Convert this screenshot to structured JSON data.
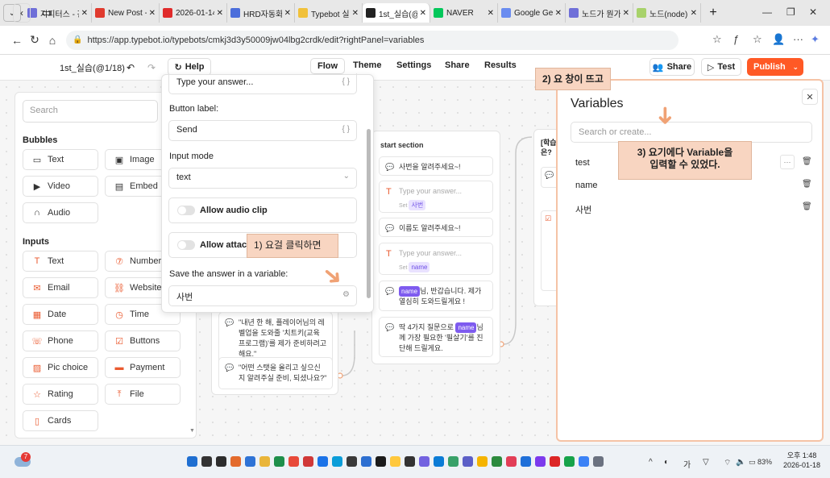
{
  "browser": {
    "tabs": [
      {
        "label": "지피터스 - 관",
        "color": "#6f6fd8",
        "active": false
      },
      {
        "label": "New Post - AI",
        "color": "#e03a2e",
        "active": false
      },
      {
        "label": "2026-01-14 |",
        "color": "#e02b2b",
        "active": false
      },
      {
        "label": "HRD자동화 1",
        "color": "#4c6edb",
        "active": false
      },
      {
        "label": "Typebot 실습",
        "color": "#f1c13a",
        "active": false
      },
      {
        "label": "1st_실습(@1/",
        "color": "#222222",
        "active": true
      },
      {
        "label": "NAVER",
        "color": "#03c75a",
        "active": false
      },
      {
        "label": "Google Gemi",
        "color": "#6a8cf0",
        "active": false
      },
      {
        "label": "노드가 뭔가요",
        "color": "#6f6fd8",
        "active": false
      },
      {
        "label": "노드(node) 의",
        "color": "#a8d26b",
        "active": false
      }
    ],
    "url": "https://app.typebot.io/typebots/cmkj3d3y50009jw04lbg2crdk/edit?rightPanel=variables"
  },
  "header": {
    "bot_name": "1st_실습(@1/18)",
    "help_label": "Help",
    "nav": [
      "Flow",
      "Theme",
      "Settings",
      "Share",
      "Results"
    ],
    "share_label": "Share",
    "test_label": "Test",
    "publish_label": "Publish"
  },
  "sidebar": {
    "search_placeholder": "Search",
    "bubbles_title": "Bubbles",
    "bubbles": [
      {
        "label": "Text",
        "icon": "chat-icon"
      },
      {
        "label": "Image",
        "icon": "image-icon"
      },
      {
        "label": "Video",
        "icon": "video-icon"
      },
      {
        "label": "Embed",
        "icon": "embed-icon"
      },
      {
        "label": "Audio",
        "icon": "headphones-icon"
      }
    ],
    "inputs_title": "Inputs",
    "inputs": [
      {
        "label": "Text",
        "icon": "text-cursor-icon"
      },
      {
        "label": "Number",
        "icon": "number-icon"
      },
      {
        "label": "Email",
        "icon": "mail-icon"
      },
      {
        "label": "Website",
        "icon": "link-icon"
      },
      {
        "label": "Date",
        "icon": "calendar-icon"
      },
      {
        "label": "Time",
        "icon": "clock-icon"
      },
      {
        "label": "Phone",
        "icon": "phone-icon"
      },
      {
        "label": "Buttons",
        "icon": "checkbox-icon"
      },
      {
        "label": "Pic choice",
        "icon": "picture-icon"
      },
      {
        "label": "Payment",
        "icon": "card-icon"
      },
      {
        "label": "Rating",
        "icon": "star-icon"
      },
      {
        "label": "File",
        "icon": "upload-icon"
      },
      {
        "label": "Cards",
        "icon": "cards-icon"
      }
    ]
  },
  "popover": {
    "placeholder_value": "Type your answer...",
    "button_label_title": "Button label:",
    "button_label_value": "Send",
    "input_mode_title": "Input mode",
    "input_mode_value": "text",
    "allow_audio_label": "Allow audio clip",
    "allow_attach_label": "Allow attach",
    "save_answer_title": "Save the answer in a variable:",
    "save_answer_value": "사번"
  },
  "cards": {
    "left_bubbles": [
      "\"내년 한 해, 플레이어님의 레벨업을 도와줄 '치트키(교육 프로그램)'를 제가 준비하려고 해요.\"",
      "\"어떤 스탯을 올리고 싶으신지 알려주실 준비, 되셨나요?\""
    ],
    "start": {
      "title": "start section",
      "b1": "사번을 알려주세요~!",
      "input_placeholder": "Type your answer...",
      "save_prefix": "Set",
      "save_var1": "사번",
      "b2": "이름도 알려주세요~!",
      "save_var2": "name",
      "name_tag": "name",
      "b3_rest": "님, 반갑습니다. 제가 열심히 도와드릴게요 !",
      "b4_pre": "딱 4가지 질문으로 ",
      "b4_post": "님께 가장 필요한 '필살기'를 진단해 드릴게요."
    },
    "partial_title": "[학습\n은?"
  },
  "variables": {
    "title": "Variables",
    "search_placeholder": "Search or create...",
    "items": [
      "test",
      "name",
      "사번"
    ]
  },
  "annotations": {
    "step1": "1) 요걸 클릭하면",
    "step2": "2) 요 창이 뜨고",
    "step3": "3) 요기에다 Variable을\n입력할 수 있었다."
  },
  "taskbar": {
    "time": "오후 1:48",
    "date": "2026-01-18",
    "battery": "83%",
    "notification_count": "7",
    "icons": [
      "#1f6fd1",
      "#333333",
      "#2d2d2d",
      "#e36b2d",
      "#2e73d6",
      "#e9b53a",
      "#1e8f4b",
      "#e84a3a",
      "#d03838",
      "#1a73e8",
      "#0a9dd9",
      "#3a3a3a",
      "#2c6fd1",
      "#1b1b1b",
      "#ffc83d",
      "#333333",
      "#7262e0",
      "#0b7cd6",
      "#38a169",
      "#5b5fc7",
      "#f5b400",
      "#2b8a3e",
      "#e23e57",
      "#1e6fd9",
      "#7c3aed",
      "#dc2626",
      "#16a34a",
      "#3b82f6",
      "#6b7280"
    ]
  }
}
